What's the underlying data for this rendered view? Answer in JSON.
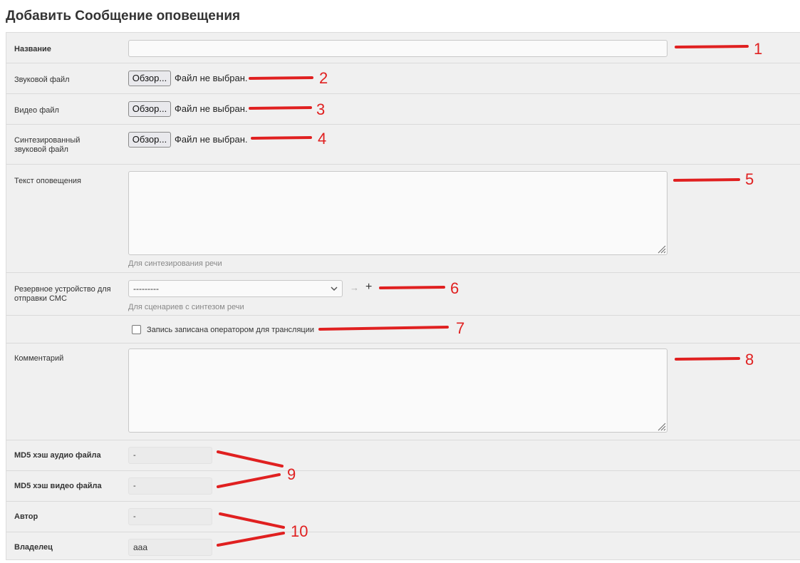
{
  "page": {
    "title": "Добавить Сообщение оповещения"
  },
  "fields": {
    "name": {
      "label": "Название",
      "value": ""
    },
    "sound_file": {
      "label": "Звуковой файл",
      "button": "Обзор...",
      "status": "Файл не выбран."
    },
    "video_file": {
      "label": "Видео файл",
      "button": "Обзор...",
      "status": "Файл не выбран."
    },
    "synth_file": {
      "label_line1": "Синтезированный",
      "label_line2": "звуковой файл",
      "button": "Обзор...",
      "status": "Файл не выбран."
    },
    "alert_text": {
      "label": "Текст оповещения",
      "value": "",
      "help": "Для синтезирования речи"
    },
    "backup_device": {
      "label_line1": "Резервное устройство для",
      "label_line2": "отправки СМС",
      "selected": "---------",
      "arrow": "→",
      "plus": "+",
      "help": "Для сценариев с синтезом речи"
    },
    "operator_record": {
      "label": "Запись записана оператором для трансляции",
      "checked": false
    },
    "comment": {
      "label": "Комментарий",
      "value": ""
    },
    "md5_audio": {
      "label": "MD5 хэш аудио файла",
      "value": "-"
    },
    "md5_video": {
      "label": "MD5 хэш видео файла",
      "value": "-"
    },
    "author": {
      "label": "Автор",
      "value": "-"
    },
    "owner": {
      "label": "Владелец",
      "value": "aaa"
    }
  },
  "callouts": [
    "1",
    "2",
    "3",
    "4",
    "5",
    "6",
    "7",
    "8",
    "9",
    "10"
  ],
  "colors": {
    "annotation": "#e02020",
    "form_bg": "#f0f0f0"
  }
}
